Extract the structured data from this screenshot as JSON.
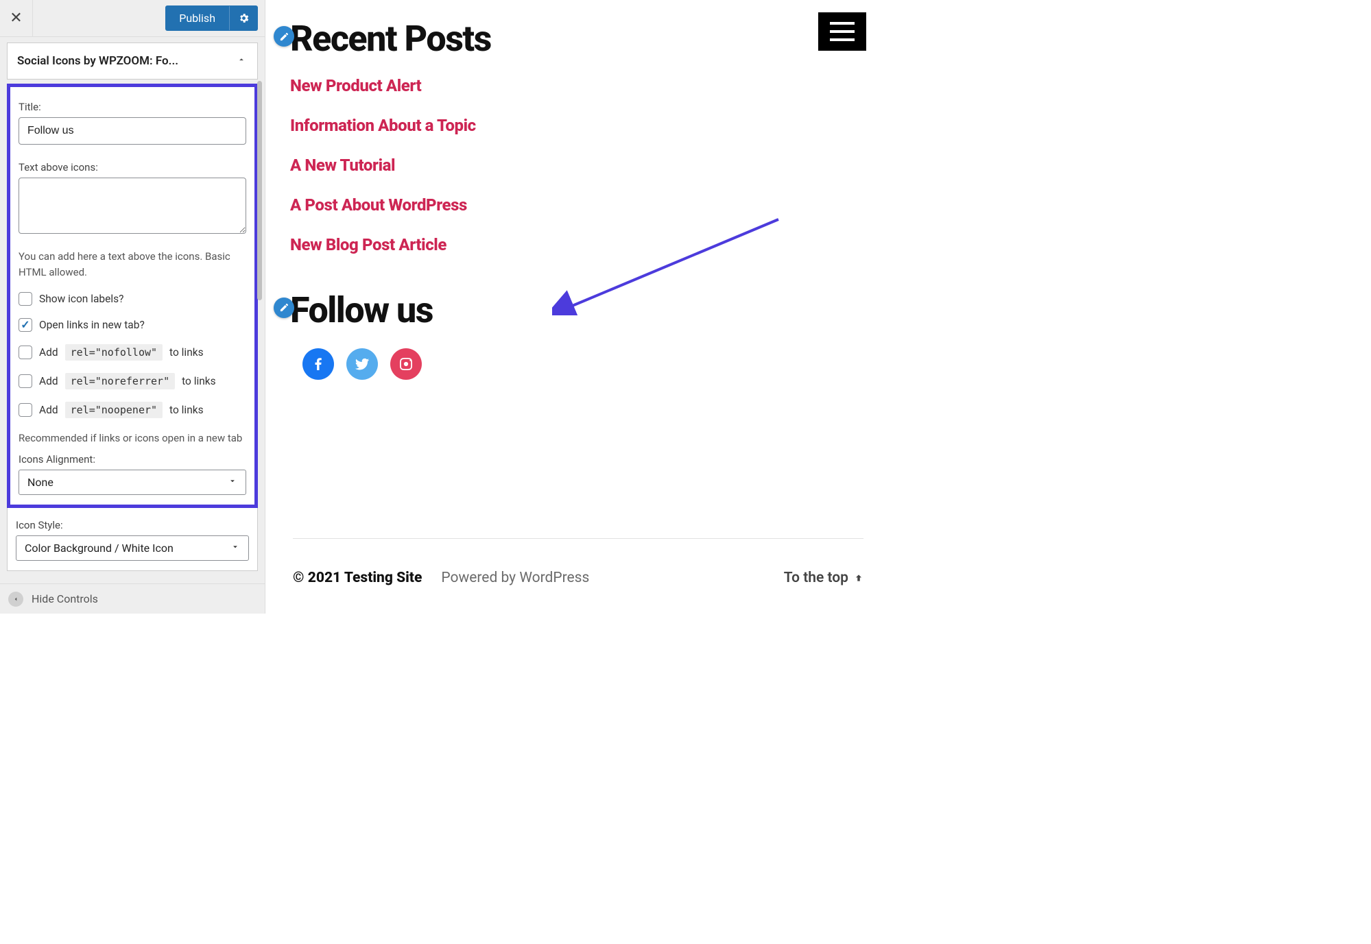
{
  "sidebar": {
    "publish_label": "Publish",
    "accordion_title": "Social Icons by WPZOOM: Fo...",
    "title_label": "Title:",
    "title_value": "Follow us",
    "text_above_label": "Text above icons:",
    "text_above_value": "",
    "hint_text": "You can add here a text above the icons. Basic HTML allowed.",
    "chk_show_labels": {
      "label": "Show icon labels?",
      "checked": false
    },
    "chk_new_tab": {
      "label": "Open links in new tab?",
      "checked": true
    },
    "chk_nofollow": {
      "prefix": "Add",
      "code": "rel=\"nofollow\"",
      "suffix": "to links",
      "checked": false
    },
    "chk_noreferrer": {
      "prefix": "Add",
      "code": "rel=\"noreferrer\"",
      "suffix": "to links",
      "checked": false
    },
    "chk_noopener": {
      "prefix": "Add",
      "code": "rel=\"noopener\"",
      "suffix": "to links",
      "checked": false
    },
    "recommend_text": "Recommended if links or icons open in a new tab",
    "align_label": "Icons Alignment:",
    "align_value": "None",
    "style_label": "Icon Style:",
    "style_value": "Color Background / White Icon",
    "hide_controls": "Hide Controls"
  },
  "preview": {
    "recent_title": "Recent Posts",
    "posts": [
      "New Product Alert",
      "Information About a Topic",
      "A New Tutorial",
      "A Post About WordPress",
      "New Blog Post Article"
    ],
    "follow_title": "Follow us",
    "social_icons": [
      "facebook",
      "twitter",
      "instagram"
    ],
    "footer_copy": "© 2021 Testing Site",
    "footer_powered": "Powered by WordPress",
    "footer_top": "To the top"
  }
}
